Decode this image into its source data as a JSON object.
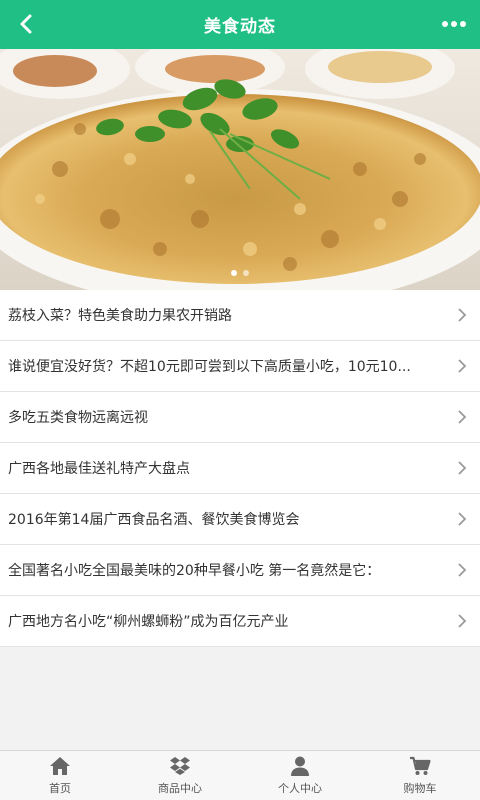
{
  "header": {
    "title": "美食动态",
    "back_icon": "chevron-left-icon",
    "more_icon": "more-dots-icon"
  },
  "banner": {
    "slide_count": 2,
    "active_index": 0
  },
  "news": [
    "荔枝入菜？特色美食助力果农开销路",
    "谁说便宜没好货？不超10元即可尝到以下高质量小吃，10元10...",
    "多吃五类食物远离远视",
    "广西各地最佳送礼特产大盘点",
    "2016年第14届广西食品名酒、餐饮美食博览会",
    "全国著名小吃全国最美味的20种早餐小吃 第一名竟然是它：",
    "广西地方名小吃“柳州螺蛳粉”成为百亿元产业"
  ],
  "bottom_nav": [
    {
      "label": "首页",
      "icon": "home-icon"
    },
    {
      "label": "商品中心",
      "icon": "dropbox-icon"
    },
    {
      "label": "个人中心",
      "icon": "user-icon"
    },
    {
      "label": "购物车",
      "icon": "cart-icon"
    }
  ],
  "colors": {
    "accent": "#1fbf86",
    "chevron": "#9a9a9a",
    "nav_icon": "#666666"
  }
}
